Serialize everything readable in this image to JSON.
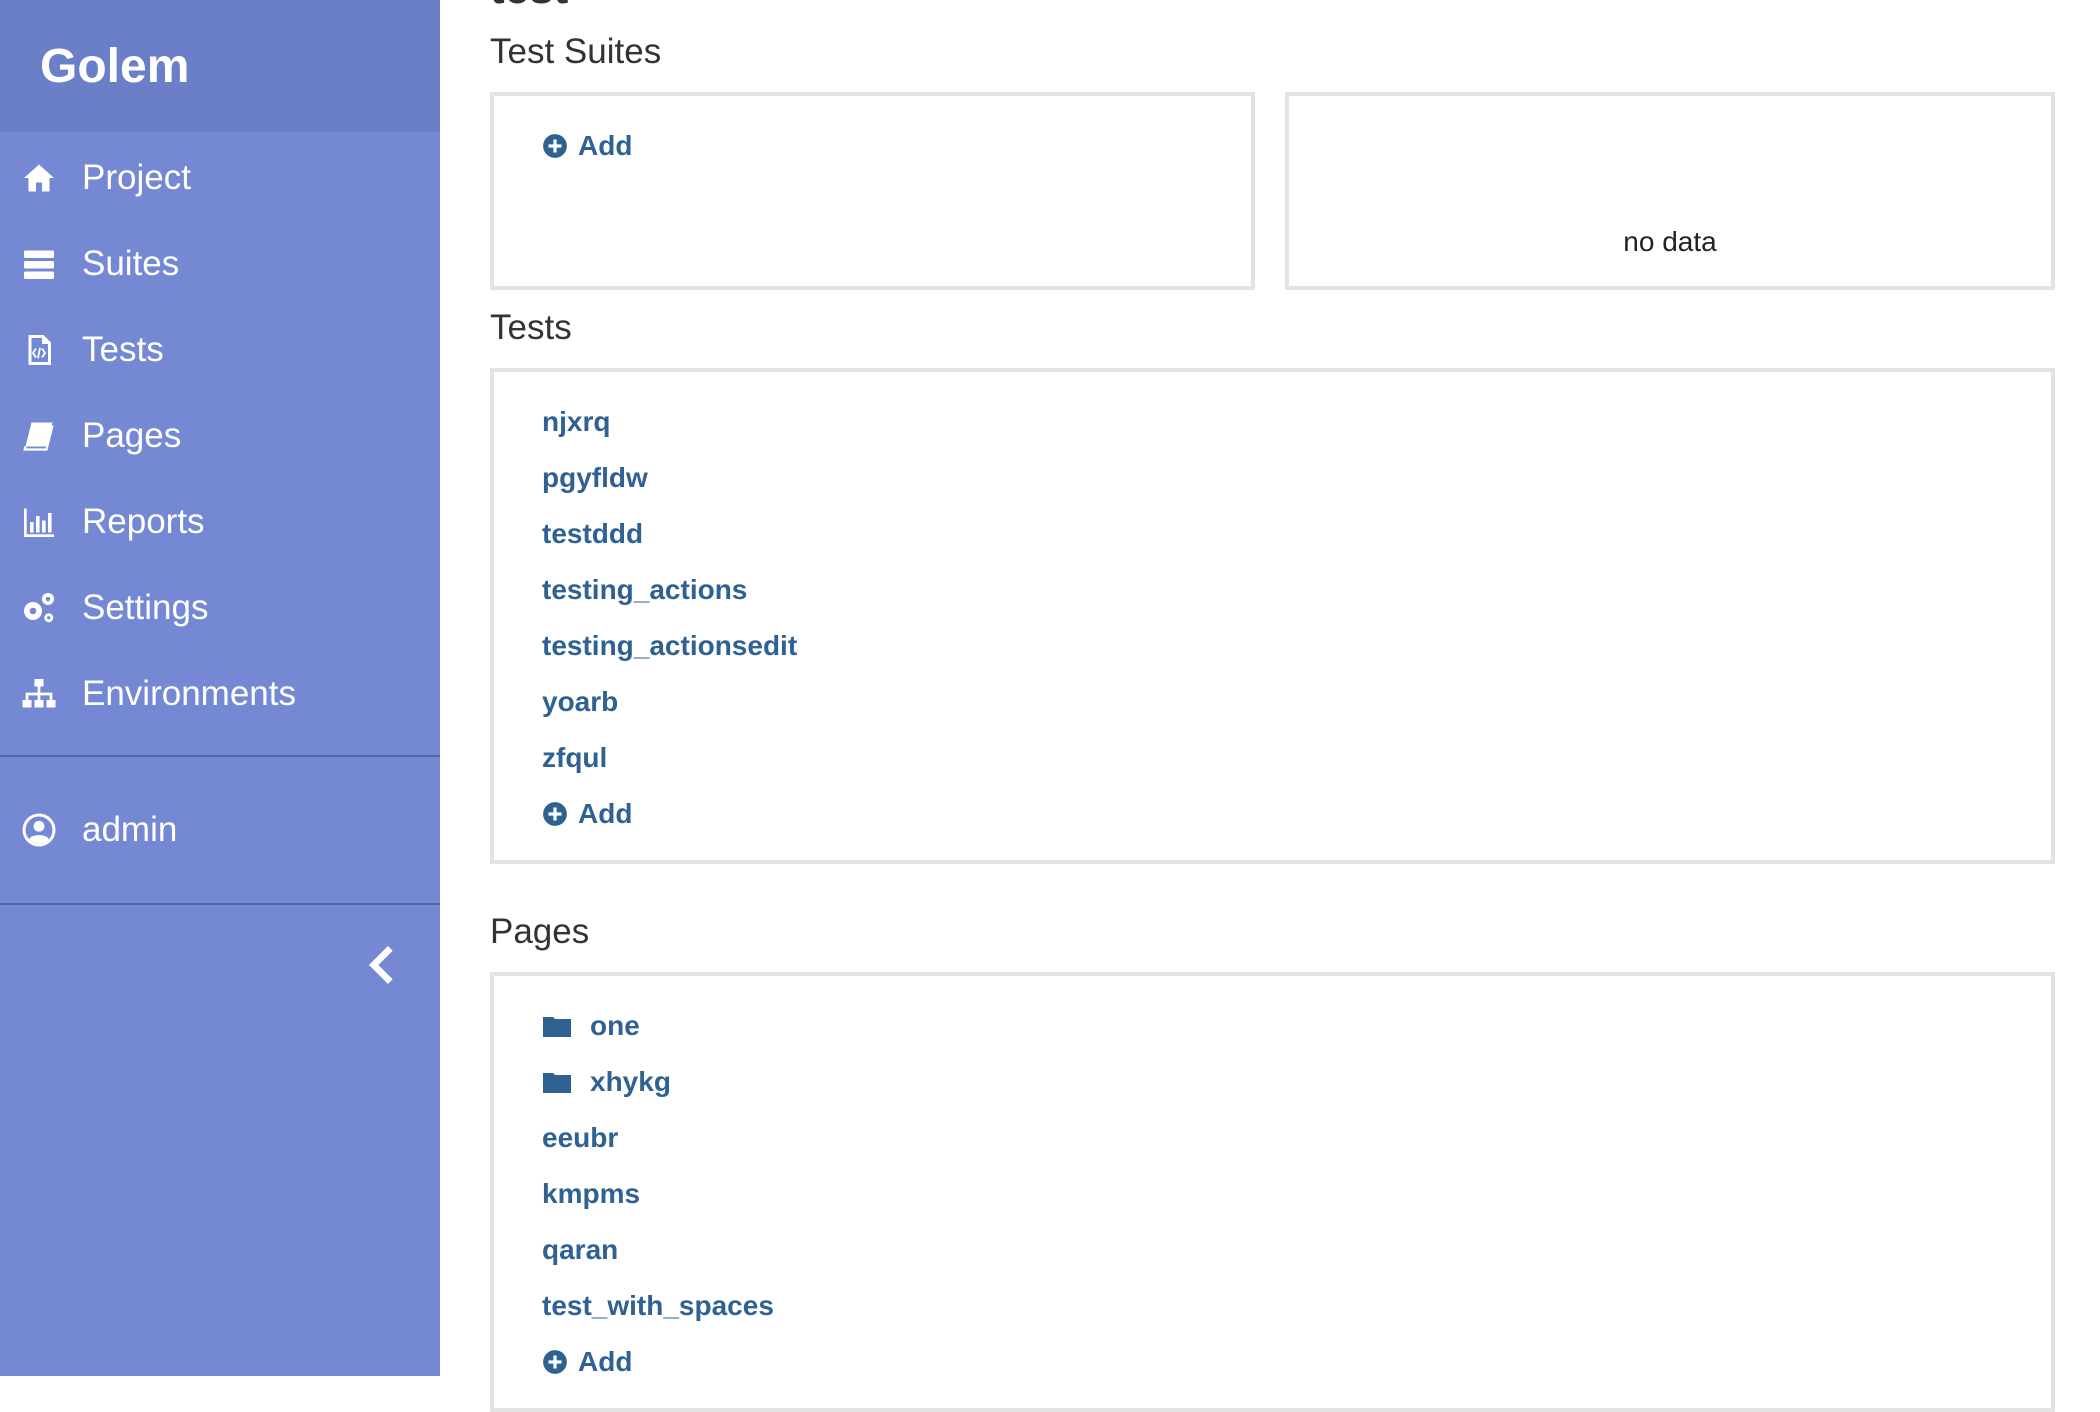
{
  "app": {
    "brand": "Golem"
  },
  "sidebar": {
    "items": [
      {
        "label": "Project",
        "icon": "home-icon"
      },
      {
        "label": "Suites",
        "icon": "server-icon"
      },
      {
        "label": "Tests",
        "icon": "code-file-icon"
      },
      {
        "label": "Pages",
        "icon": "book-icon"
      },
      {
        "label": "Reports",
        "icon": "bar-chart-icon"
      },
      {
        "label": "Settings",
        "icon": "gears-icon"
      },
      {
        "label": "Environments",
        "icon": "sitemap-icon"
      }
    ],
    "user": {
      "label": "admin",
      "icon": "user-circle-icon"
    },
    "collapse_icon": "chevron-left-icon"
  },
  "main": {
    "project_title": "test",
    "suites": {
      "title": "Test Suites",
      "add_label": "Add",
      "no_data": "no data"
    },
    "tests": {
      "title": "Tests",
      "items": [
        "njxrq",
        "pgyfldw",
        "testddd",
        "testing_actions",
        "testing_actionsedit",
        "yoarb",
        "zfqul"
      ],
      "add_label": "Add"
    },
    "pages": {
      "title": "Pages",
      "folders": [
        "one",
        "xhykg"
      ],
      "items": [
        "eeubr",
        "kmpms",
        "qaran",
        "test_with_spaces"
      ],
      "add_label": "Add"
    }
  },
  "colors": {
    "sidebar": "#7588d4",
    "brand_bar": "#6b7fc8",
    "link": "#2f6193",
    "card_border": "#e3e3e3"
  }
}
